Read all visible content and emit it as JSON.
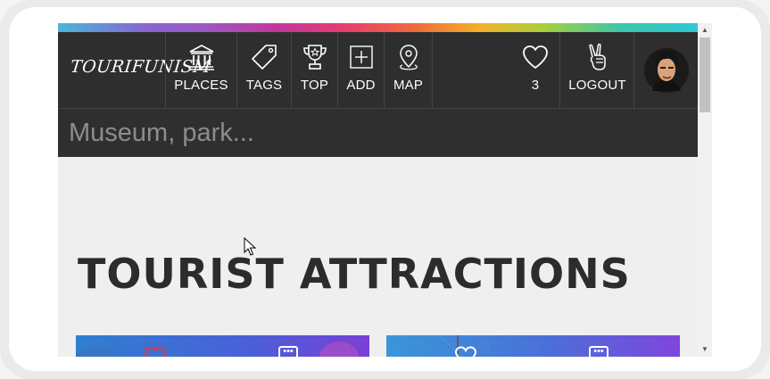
{
  "app": {
    "logo": "TOURIFUNISM"
  },
  "nav": {
    "items": [
      {
        "label": "PLACES",
        "icon": "museum-icon"
      },
      {
        "label": "TAGS",
        "icon": "tag-icon"
      },
      {
        "label": "TOP",
        "icon": "trophy-icon"
      },
      {
        "label": "ADD",
        "icon": "add-square-icon"
      },
      {
        "label": "MAP",
        "icon": "map-pin-icon"
      }
    ],
    "favorites_count": "3",
    "logout_label": "LOGOUT",
    "logout_icon": "peace-hand-icon",
    "favorites_icon": "heart-icon"
  },
  "search": {
    "placeholder": "Museum, park..."
  },
  "main": {
    "title": "TOURIST ATTRACTIONS"
  },
  "colors": {
    "navbar": "#2e2e2e",
    "content_bg": "#efefef",
    "title_text": "#2c2c2c",
    "card_fav_red": "#e0363e"
  }
}
